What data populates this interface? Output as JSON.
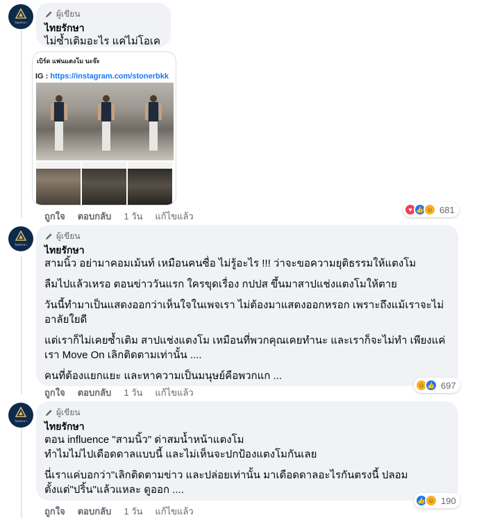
{
  "comments": [
    {
      "badge": "ผู้เขียน",
      "author": "ไทยรักษา",
      "paragraphs": [
        "ไม่ซ้ำเติมอะไร แค่ไม่โอเค .."
      ],
      "attachment": {
        "title": "เบิร์ด แฟนแตงโม นะจ๊ะ",
        "ig_label": "IG :",
        "ig_url": "https://instagram.com/stonerbkk"
      },
      "actions": {
        "like": "ถูกใจ",
        "reply": "ตอบกลับ",
        "time": "1 วัน",
        "edited": "แก้ไขแล้ว"
      },
      "reactions": {
        "icons": [
          "love-icon",
          "like-icon",
          "haha-icon"
        ],
        "count": "681"
      }
    },
    {
      "badge": "ผู้เขียน",
      "author": "ไทยรักษา",
      "paragraphs": [
        "สามนิ้ว อย่ามาคอมเม้นท์ เหมือนคนซื่อ ไม่รู้อะไร !!! ว่าจะขอความยุติธรรมให้แตงโม",
        "ลืมไปแล้วเหรอ ตอนข่าววันแรก ใครขุดเรื่อง กปปส ขึ้นมาสาปแช่งแตงโมให้ตาย",
        "วันนี้ทำมาเป็นแสดงออกว่าเห็นใจในเพจเรา ไม่ต้องมาแสดงออกหรอก เพราะถึงแม้เราจะไม่\nอาลัยใยดี",
        "แต่เราก็ไม่เคยซ้ำเติม สาปแช่งแตงโม เหมือนที่พวกคุณเคยทำนะ และเราก็จะไม่ทำ เพียงแค่\nเรา Move On เลิกติดตามเท่านั้น ....",
        "คนที่ต้องแยกแยะ และหาความเป็นมนุษย์คือพวกแก ..."
      ],
      "actions": {
        "like": "ถูกใจ",
        "reply": "ตอบกลับ",
        "time": "1 วัน",
        "edited": "แก้ไขแล้ว"
      },
      "reactions": {
        "icons": [
          "haha-icon",
          "like-icon"
        ],
        "count": "697"
      }
    },
    {
      "badge": "ผู้เขียน",
      "author": "ไทยรักษา",
      "paragraphs": [
        "ตอน influence \"สามนิ้ว\" ด่าสมน้ำหน้าแตงโม\nทำไมไม่ไปเดือดดาลแบบนี้ และไม่เห็นจะปกป้องแตงโมกันเลย",
        "นี่เราแค่บอกว่า\"เลิกติดตามข่าว และปล่อยเท่านั้น มาเดือดดาลอะไรกันตรงนี้ ปลอม\nตั้งแต่\"ปริ้น\"แล้วแหละ ดูออก ...."
      ],
      "actions": {
        "like": "ถูกใจ",
        "reply": "ตอบกลับ",
        "time": "1 วัน",
        "edited": "แก้ไขแล้ว"
      },
      "reactions": {
        "icons": [
          "like-icon",
          "haha-icon"
        ],
        "count": "190"
      }
    }
  ],
  "colors": {
    "bubble": "#f0f2f5",
    "text": "#050505",
    "meta": "#65676b",
    "like": "#1877f2",
    "love": "#f33e58",
    "haha": "#f7b125",
    "avatar": "#0e2a4a"
  }
}
